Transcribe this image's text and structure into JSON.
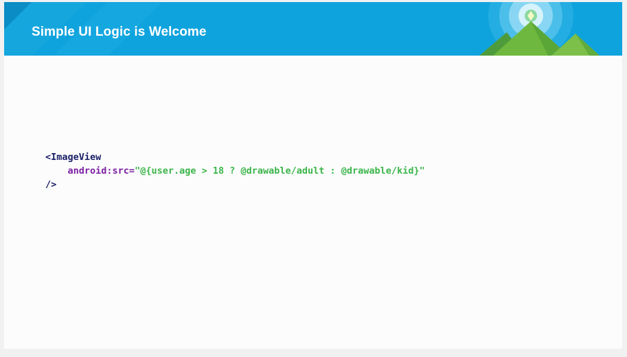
{
  "header": {
    "title": "Simple UI Logic is Welcome"
  },
  "code": {
    "line1_tag": "<ImageView",
    "line2_indent": "    ",
    "line2_attr": "android:src=",
    "line2_value": "\"@{user.age > 18 ? @drawable/adult : @drawable/kid}\"",
    "line3_close": "/>"
  },
  "colors": {
    "header_bg": "#0fa3dd",
    "tag": "#1a1f66",
    "attribute": "#7b1fa2",
    "string_value": "#3bb54a"
  },
  "icons": {
    "header_art": "mountain-sun-icon"
  }
}
